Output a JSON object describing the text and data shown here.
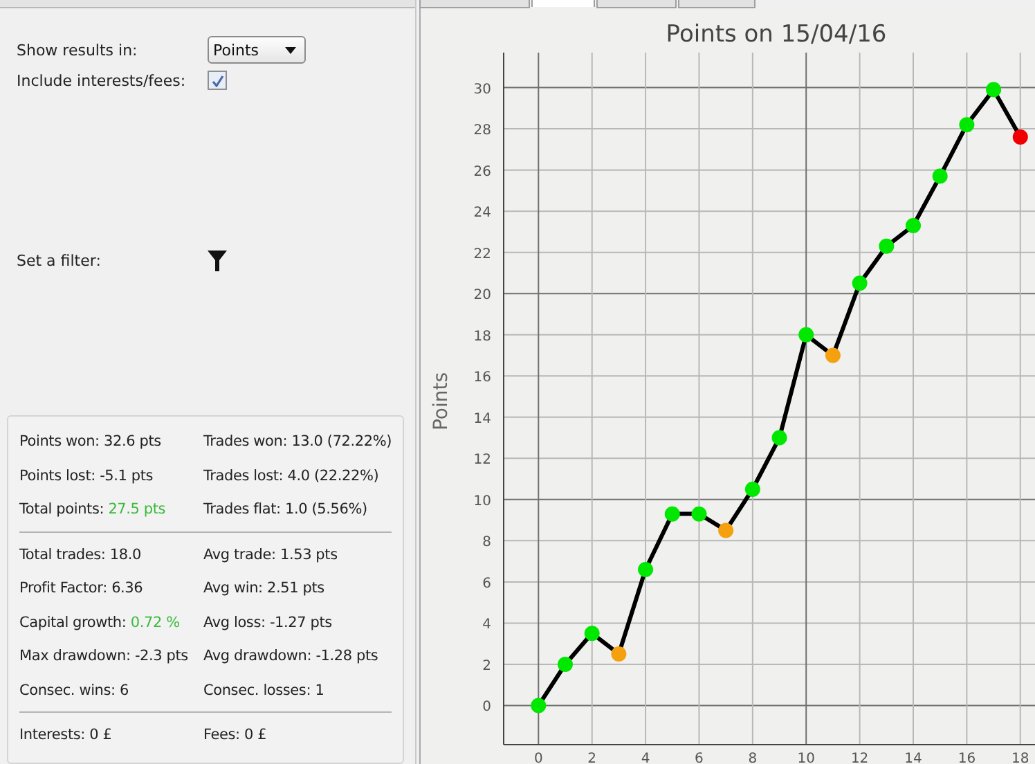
{
  "tabs": [
    {
      "selected": false
    },
    {
      "selected": true
    },
    {
      "selected": false
    },
    {
      "selected": false
    }
  ],
  "settings": {
    "show_results_label": "Show results in:",
    "show_results_value": "Points",
    "include_fees_label": "Include interests/fees:",
    "include_fees_checked": true,
    "filter_label": "Set a filter:"
  },
  "stats": [
    [
      {
        "label": "Points won:",
        "value": "32.6 pts",
        "positive": false
      },
      {
        "label": "Trades won:",
        "value": "13.0 (72.22%)",
        "positive": false
      }
    ],
    [
      {
        "label": "Points lost:",
        "value": "-5.1 pts",
        "positive": false
      },
      {
        "label": "Trades lost:",
        "value": "4.0 (22.22%)",
        "positive": false
      }
    ],
    [
      {
        "label": "Total points:",
        "value": "27.5 pts",
        "positive": true
      },
      {
        "label": "Trades flat:",
        "value": "1.0 (5.56%)",
        "positive": false
      }
    ],
    [
      {
        "kind": "divider"
      }
    ],
    [
      {
        "label": "Total trades:",
        "value": "18.0",
        "positive": false
      },
      {
        "label": "Avg trade:",
        "value": "1.53 pts",
        "positive": false
      }
    ],
    [
      {
        "label": "Profit Factor:",
        "value": "6.36",
        "positive": false
      },
      {
        "label": "Avg win:",
        "value": "2.51 pts",
        "positive": false
      }
    ],
    [
      {
        "label": "Capital growth:",
        "value": "0.72 %",
        "positive": true
      },
      {
        "label": "Avg loss:",
        "value": "-1.27 pts",
        "positive": false
      }
    ],
    [
      {
        "label": "Max drawdown:",
        "value": "-2.3 pts",
        "positive": false
      },
      {
        "label": "Avg drawdown:",
        "value": "-1.28 pts",
        "positive": false
      }
    ],
    [
      {
        "label": "Consec. wins:",
        "value": "6",
        "positive": false
      },
      {
        "label": "Consec. losses:",
        "value": "1",
        "positive": false
      }
    ],
    [
      {
        "kind": "divider"
      }
    ],
    [
      {
        "label": "Interests:",
        "value": "0 £",
        "positive": false
      },
      {
        "label": "Fees:",
        "value": "0 £",
        "positive": false
      }
    ]
  ],
  "chart": {
    "chart_data": {
      "type": "line",
      "title": "Points on 15/04/16",
      "ylabel": "Points",
      "x": [
        0,
        1,
        2,
        3,
        4,
        5,
        6,
        7,
        8,
        9,
        10,
        11,
        12,
        13,
        14,
        15,
        16,
        17,
        18
      ],
      "grid": true,
      "series": [
        {
          "color": "#000000",
          "marker": "circle",
          "values": [
            0,
            2.0,
            3.5,
            2.5,
            6.6,
            9.3,
            9.3,
            8.5,
            10.5,
            13.0,
            18.0,
            17.0,
            20.5,
            22.3,
            23.3,
            25.7,
            28.2,
            29.9,
            27.6
          ]
        }
      ],
      "xlim": [
        -1.3,
        18.6
      ],
      "ylim": [
        -1.9,
        31.7
      ],
      "xticks": [
        0,
        2,
        4,
        6,
        8,
        10,
        12,
        14,
        16,
        18
      ],
      "yticks": [
        0,
        2,
        4,
        6,
        8,
        10,
        12,
        14,
        16,
        18,
        20,
        22,
        24,
        26,
        28,
        30
      ]
    },
    "markers": [
      {
        "color": "#00e800"
      },
      {
        "color": "#00e800"
      },
      {
        "color": "#00e800"
      },
      {
        "color": "#f5a00f"
      },
      {
        "color": "#00e800"
      },
      {
        "color": "#00e800"
      },
      {
        "color": "#00e800"
      },
      {
        "color": "#f5a00f"
      },
      {
        "color": "#00e800"
      },
      {
        "color": "#00e800"
      },
      {
        "color": "#00e800"
      },
      {
        "color": "#f5a00f"
      },
      {
        "color": "#00e800"
      },
      {
        "color": "#00e800"
      },
      {
        "color": "#00e800"
      },
      {
        "color": "#00e800"
      },
      {
        "color": "#00e800"
      },
      {
        "color": "#00e800"
      },
      {
        "color": "#f00000"
      }
    ]
  }
}
